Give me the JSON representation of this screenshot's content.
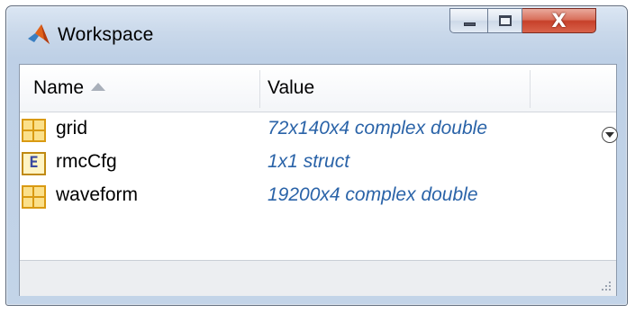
{
  "window": {
    "title": "Workspace",
    "controls": {
      "minimize": "minimize",
      "maximize": "maximize",
      "close": "X"
    }
  },
  "table": {
    "columns": {
      "name": "Name",
      "value": "Value"
    },
    "sort": {
      "column": "name",
      "direction": "ascending"
    },
    "rows": [
      {
        "name": "grid",
        "value": "72x140x4 complex double",
        "icon": "matrix-icon"
      },
      {
        "name": "rmcCfg",
        "value": "1x1 struct",
        "icon": "struct-icon"
      },
      {
        "name": "waveform",
        "value": "19200x4 complex double",
        "icon": "matrix-icon"
      }
    ]
  },
  "colors": {
    "value_text": "#2a63a8",
    "close_button": "#c7402a",
    "titlebar": "#c9d8ea"
  }
}
